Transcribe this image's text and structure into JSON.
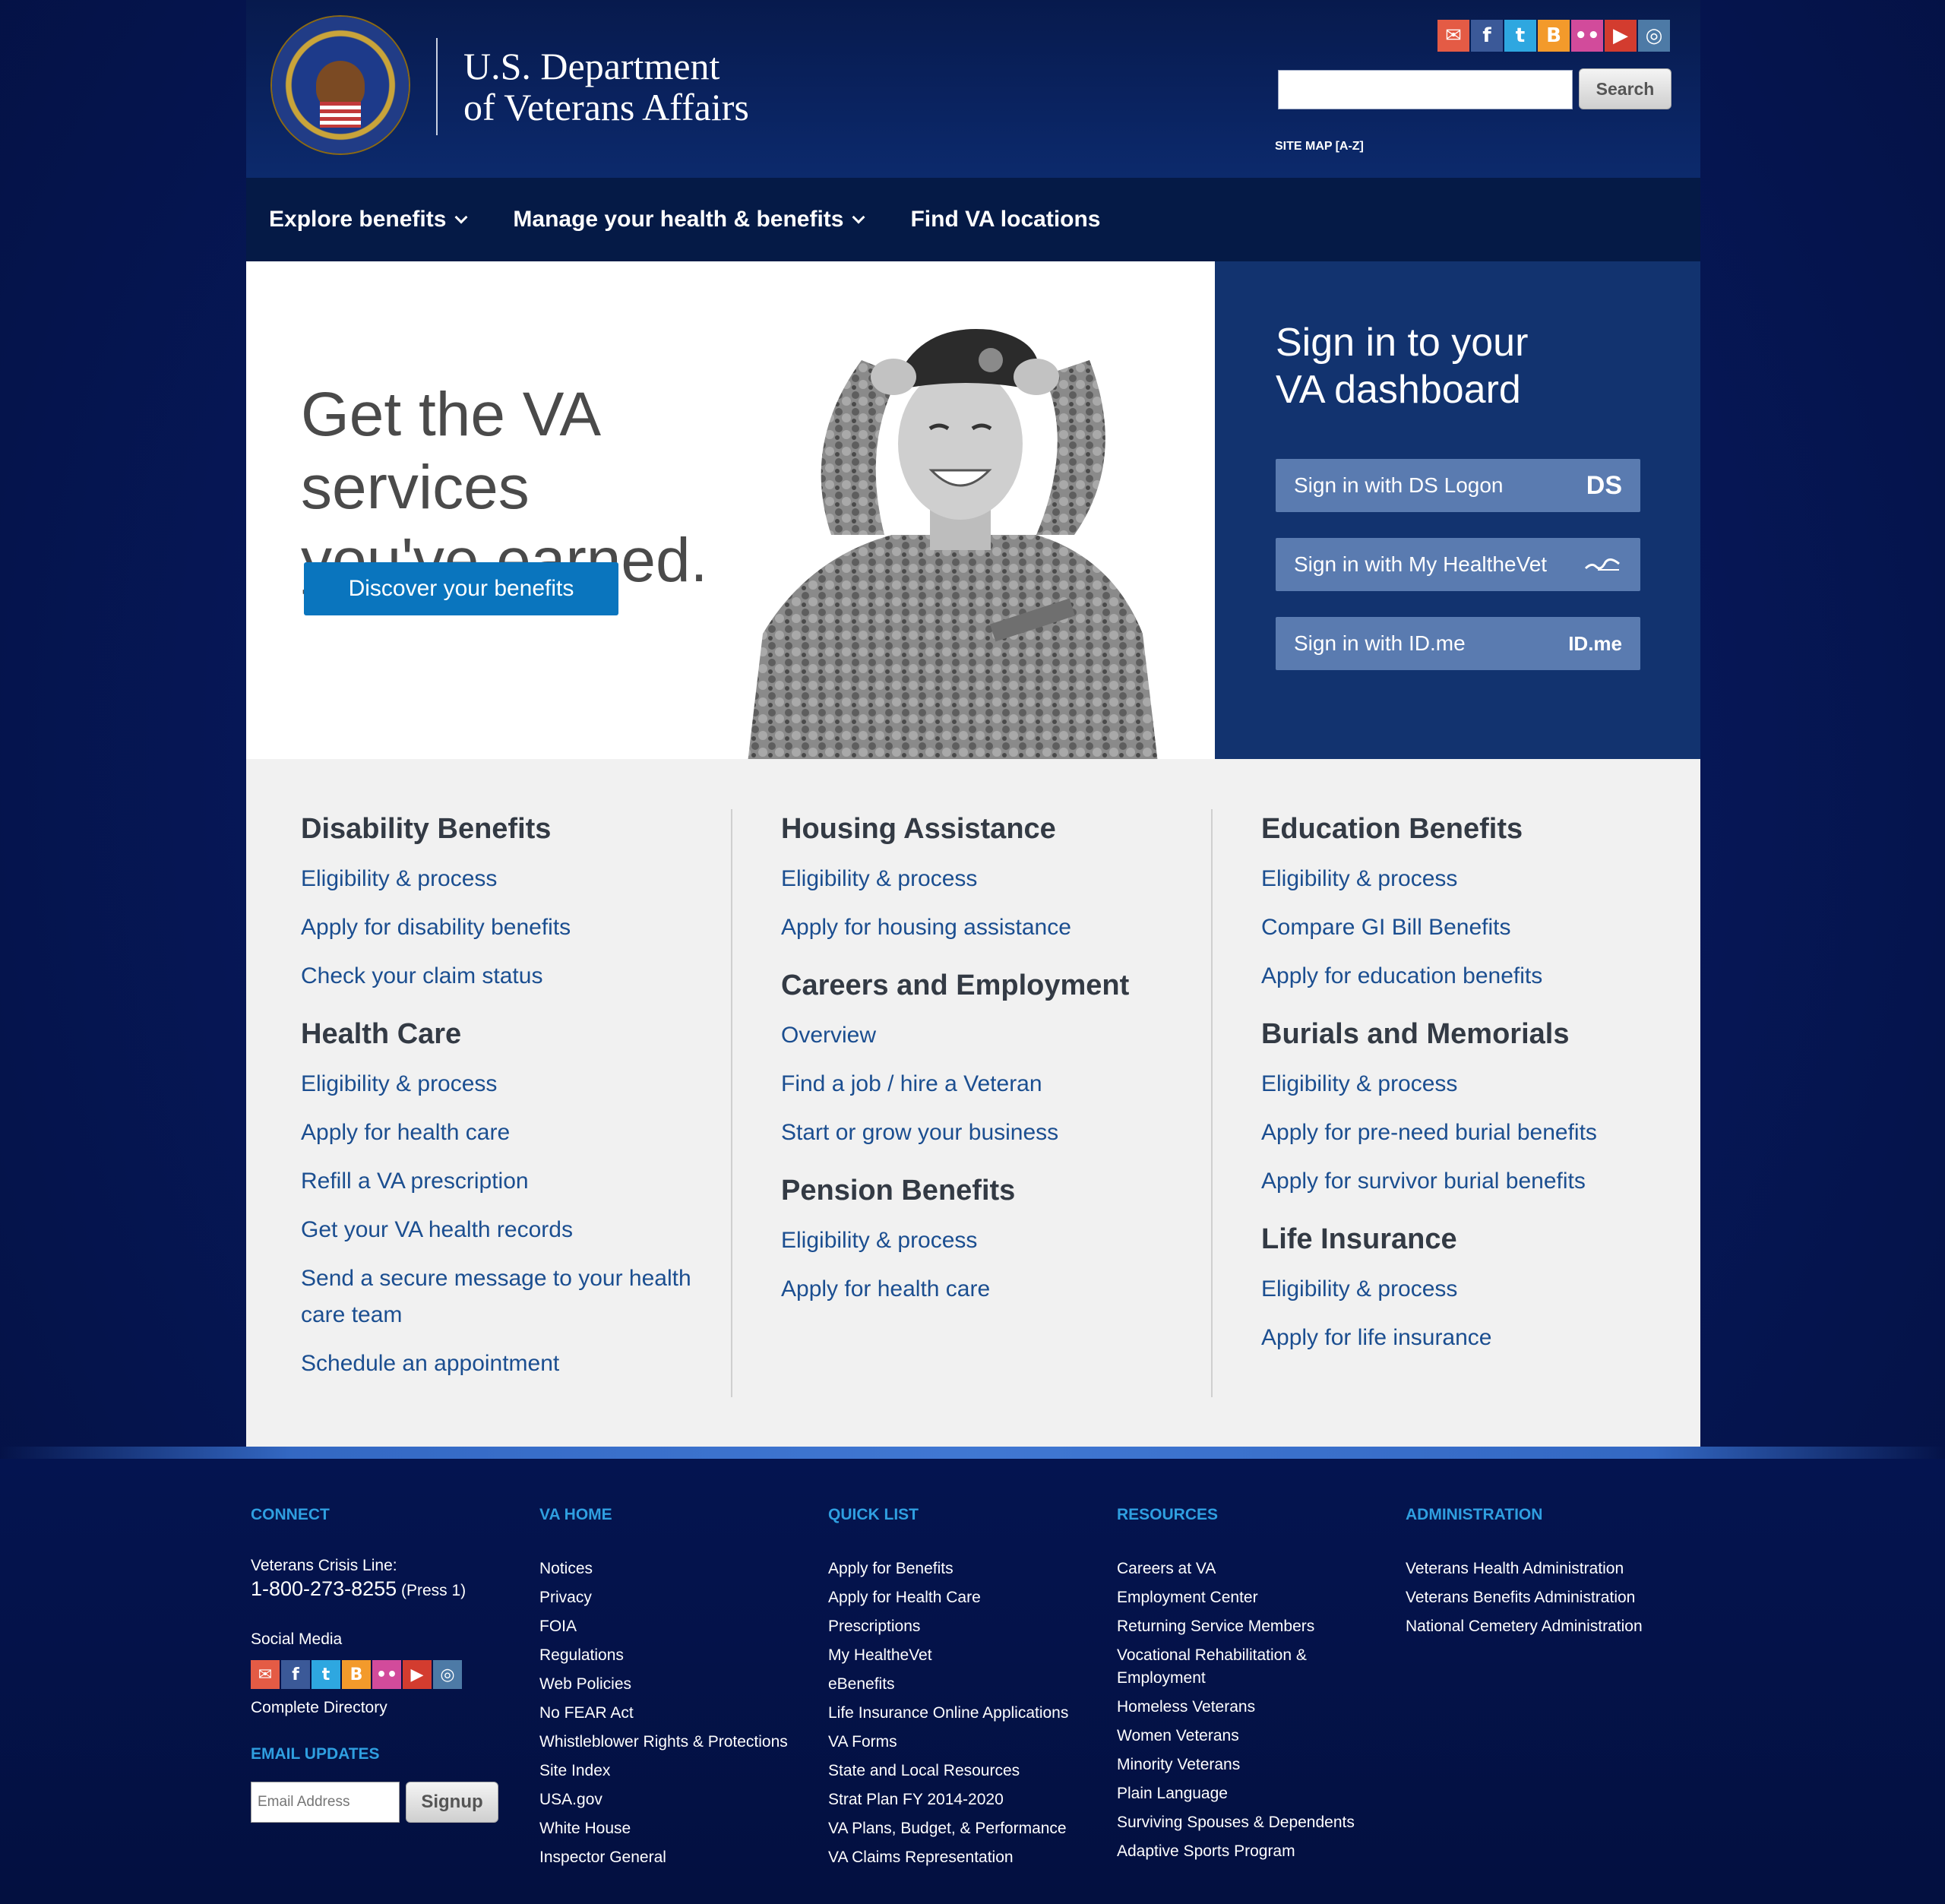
{
  "header": {
    "agency_line1": "U.S. Department",
    "agency_line2": "of Veterans Affairs",
    "search_button": "Search",
    "search_placeholder": "",
    "site_map": "SITE MAP",
    "site_map_az": "[A-Z]",
    "social_icons": [
      "email-icon",
      "facebook-icon",
      "twitter-icon",
      "blog-icon",
      "flickr-icon",
      "youtube-icon",
      "instagram-icon"
    ]
  },
  "nav": {
    "items": [
      {
        "label": "Explore benefits"
      },
      {
        "label": "Manage your health & benefits"
      },
      {
        "label": "Find VA locations"
      }
    ]
  },
  "hero": {
    "heading_line1": "Get the VA services",
    "heading_line2": "you've earned.",
    "cta": "Discover your benefits"
  },
  "signin": {
    "title_line1": "Sign in to your",
    "title_line2": "VA dashboard",
    "buttons": [
      {
        "label": "Sign in with DS Logon",
        "logo": "DS"
      },
      {
        "label": "Sign in with My HealtheVet",
        "logo": ""
      },
      {
        "label": "Sign in with ID.me",
        "logo": "ID.me"
      }
    ]
  },
  "benefits": {
    "col1": [
      {
        "title": "Disability Benefits",
        "links": [
          "Eligibility & process",
          "Apply for disability benefits",
          "Check your claim status"
        ]
      },
      {
        "title": "Health Care",
        "links": [
          "Eligibility & process",
          "Apply for health care",
          "Refill a VA prescription",
          "Get your VA health records",
          "Send a secure message to your health care team",
          "Schedule an appointment"
        ]
      }
    ],
    "col2": [
      {
        "title": "Housing Assistance",
        "links": [
          "Eligibility & process",
          "Apply for housing assistance"
        ]
      },
      {
        "title": "Careers and Employment",
        "links": [
          "Overview",
          "Find a job / hire a Veteran",
          "Start or grow your business"
        ]
      },
      {
        "title": "Pension Benefits",
        "links": [
          "Eligibility & process",
          "Apply for health care"
        ]
      }
    ],
    "col3": [
      {
        "title": "Education Benefits",
        "links": [
          "Eligibility & process",
          "Compare GI Bill Benefits",
          "Apply for education benefits"
        ]
      },
      {
        "title": "Burials and Memorials",
        "links": [
          "Eligibility & process",
          "Apply for pre-need burial benefits",
          "Apply for survivor burial benefits"
        ]
      },
      {
        "title": "Life Insurance",
        "links": [
          "Eligibility & process",
          "Apply for life insurance"
        ]
      }
    ]
  },
  "footer": {
    "connect": {
      "heading": "CONNECT",
      "crisis_label": "Veterans Crisis Line:",
      "crisis_phone": "1-800-273-8255",
      "crisis_press": "(Press 1)",
      "social_label": "Social Media",
      "directory": "Complete Directory",
      "email_heading": "EMAIL UPDATES",
      "email_placeholder": "Email Address",
      "signup": "Signup"
    },
    "va_home": {
      "heading": "VA HOME",
      "links": [
        "Notices",
        "Privacy",
        "FOIA",
        "Regulations",
        "Web Policies",
        "No FEAR Act",
        "Whistleblower Rights & Protections",
        "Site Index",
        "USA.gov",
        "White House",
        "Inspector General"
      ]
    },
    "quick_list": {
      "heading": "QUICK LIST",
      "links": [
        "Apply for Benefits",
        "Apply for Health Care",
        "Prescriptions",
        "My HealtheVet",
        "eBenefits",
        "Life Insurance Online Applications",
        "VA Forms",
        "State and Local Resources",
        "Strat Plan FY 2014-2020",
        "VA Plans, Budget, & Performance",
        "VA Claims Representation"
      ]
    },
    "resources": {
      "heading": "RESOURCES",
      "links": [
        "Careers at VA",
        "Employment Center",
        "Returning Service Members",
        "Vocational Rehabilitation & Employment",
        "Homeless Veterans",
        "Women Veterans",
        "Minority Veterans",
        "Plain Language",
        "Surviving Spouses & Dependents",
        "Adaptive Sports Program"
      ]
    },
    "administration": {
      "heading": "ADMINISTRATION",
      "links": [
        "Veterans Health Administration",
        "Veterans Benefits Administration",
        "National Cemetery Administration"
      ]
    }
  }
}
